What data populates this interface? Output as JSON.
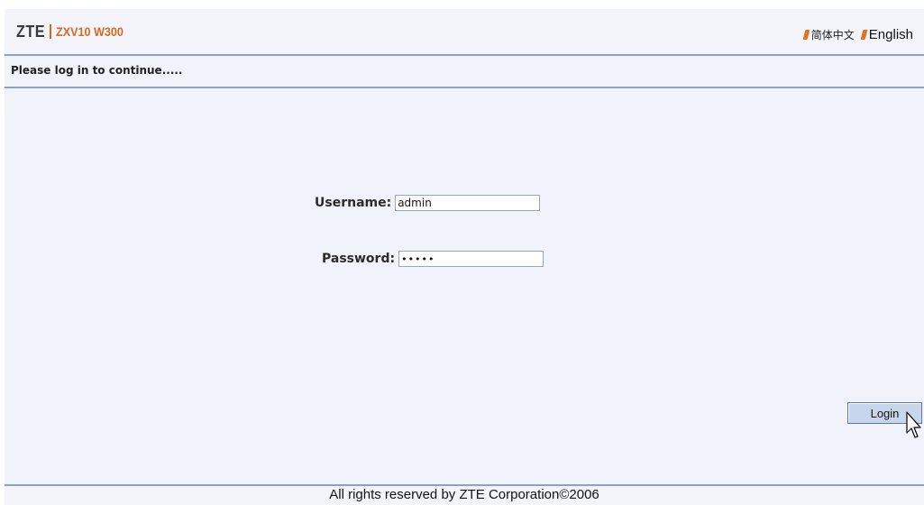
{
  "header": {
    "brand_logo": "ZTE",
    "brand_model": "ZXV10 W300",
    "languages": [
      {
        "label": "简体中文"
      },
      {
        "label": "English"
      }
    ],
    "accent_color": "#e86f1f"
  },
  "subheader": {
    "message": "Please log in to continue....."
  },
  "login_form": {
    "username_label": "Username:",
    "username_value": "admin",
    "password_label": "Password:",
    "password_value": "•••••",
    "login_label": "Login"
  },
  "footer": {
    "text": "All rights reserved by ZTE Corporation©2006"
  },
  "icons": {
    "cursor": "mouse-pointer-icon",
    "lang_marker": "orange-slash-icon"
  }
}
